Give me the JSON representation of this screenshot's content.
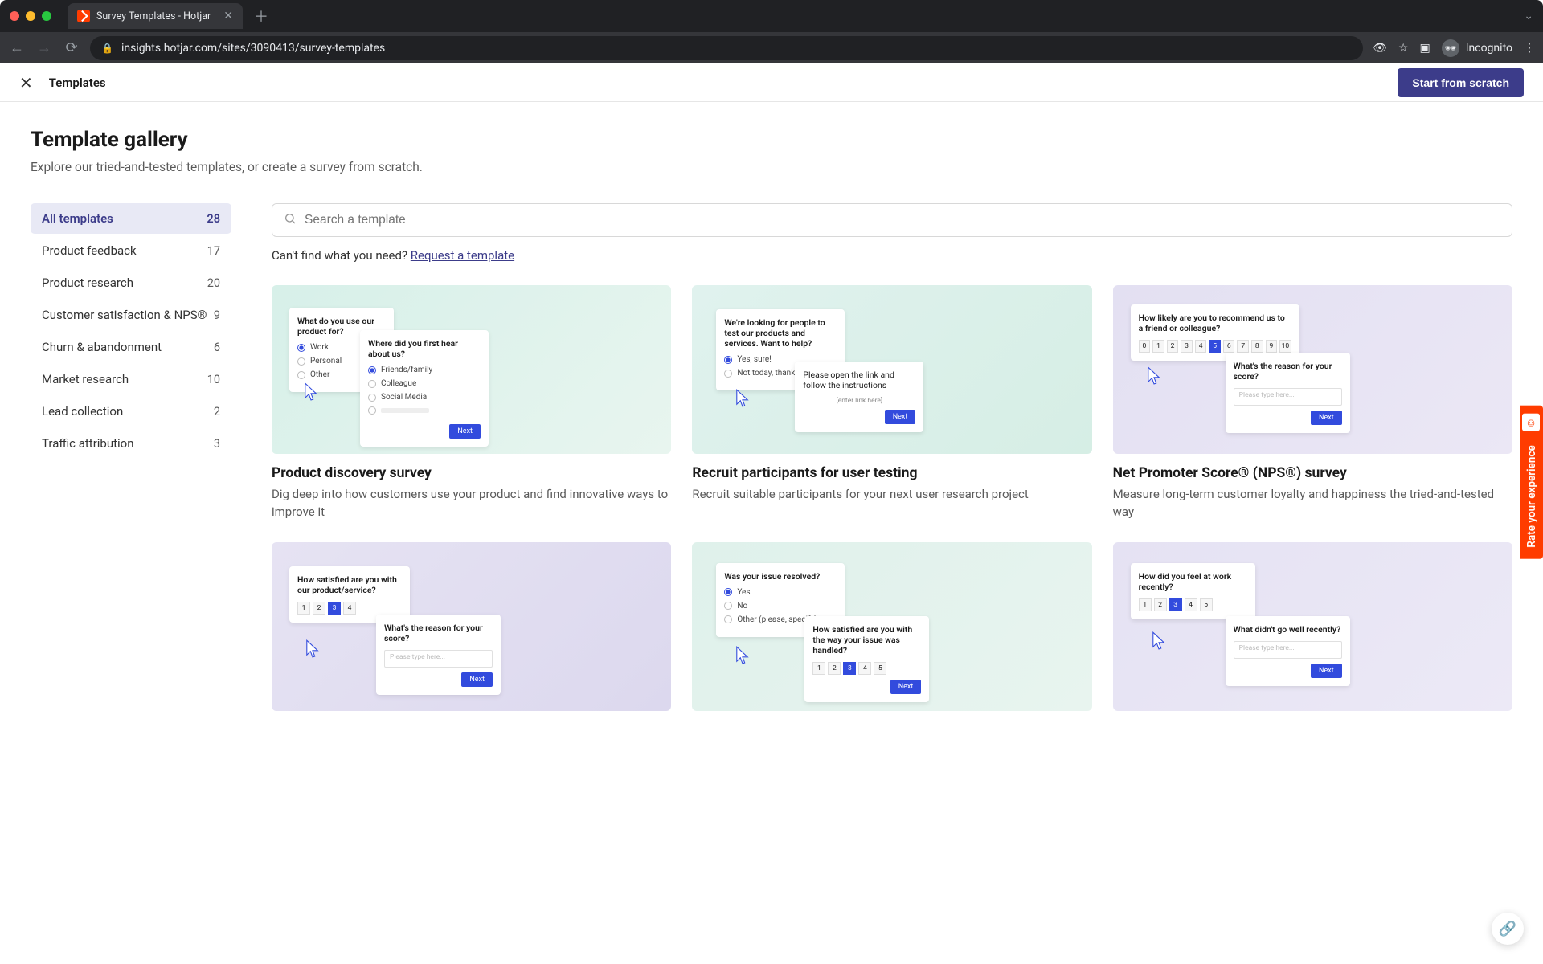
{
  "browser": {
    "tab_title": "Survey Templates - Hotjar",
    "url": "insights.hotjar.com/sites/3090413/survey-templates",
    "incognito_label": "Incognito"
  },
  "header": {
    "title": "Templates",
    "primary_button": "Start from scratch"
  },
  "page": {
    "title": "Template gallery",
    "subtitle": "Explore our tried-and-tested templates, or create a survey from scratch."
  },
  "sidebar": {
    "categories": [
      {
        "label": "All templates",
        "count": "28",
        "active": true
      },
      {
        "label": "Product feedback",
        "count": "17"
      },
      {
        "label": "Product research",
        "count": "20"
      },
      {
        "label": "Customer satisfaction & NPS®",
        "count": "9"
      },
      {
        "label": "Churn & abandonment",
        "count": "6"
      },
      {
        "label": "Market research",
        "count": "10"
      },
      {
        "label": "Lead collection",
        "count": "2"
      },
      {
        "label": "Traffic attribution",
        "count": "3"
      }
    ]
  },
  "search": {
    "placeholder": "Search a template"
  },
  "request": {
    "prefix": "Can't find what you need? ",
    "link": "Request a template"
  },
  "cards": [
    {
      "title": "Product discovery survey",
      "desc": "Dig deep into how customers use your product and find innovative ways to improve it",
      "preview": {
        "panel1_q": "What do you use our product for?",
        "panel1_opts": [
          "Work",
          "Personal",
          "Other"
        ],
        "panel1_selected": 0,
        "panel2_q": "Where did you first hear about us?",
        "panel2_opts": [
          "Friends/family",
          "Colleague",
          "Social Media"
        ],
        "panel2_selected": 0,
        "next": "Next"
      }
    },
    {
      "title": "Recruit participants for user testing",
      "desc": "Recruit suitable participants for your next user research project",
      "preview": {
        "panel1_q": "We're looking for people to test our products and services. Want to help?",
        "panel1_opts": [
          "Yes, sure!",
          "Not today, thanks"
        ],
        "panel1_selected": 0,
        "panel2_q": "Please open the link and follow the instructions",
        "panel2_placeholder": "[enter link here]",
        "next": "Next"
      }
    },
    {
      "title": "Net Promoter Score® (NPS®) survey",
      "desc": "Measure long-term customer loyalty and happiness the tried-and-tested way",
      "preview": {
        "panel1_q": "How likely are you to recommend us to a friend or colleague?",
        "scale": [
          "0",
          "1",
          "2",
          "3",
          "4",
          "5",
          "6",
          "7",
          "8",
          "9",
          "10"
        ],
        "scale_selected": 5,
        "panel2_q": "What's the reason for your score?",
        "panel2_placeholder": "Please type here...",
        "next": "Next"
      }
    },
    {
      "title": "",
      "desc": "",
      "preview": {
        "panel1_q": "How satisfied are you with our product/service?",
        "scale": [
          "1",
          "2",
          "3",
          "4"
        ],
        "scale_selected": 2,
        "panel2_q": "What's the reason for your score?",
        "panel2_placeholder": "Please type here...",
        "next": "Next"
      }
    },
    {
      "title": "",
      "desc": "",
      "preview": {
        "panel1_q": "Was your issue resolved?",
        "panel1_opts": [
          "Yes",
          "No",
          "Other (please, specify)"
        ],
        "panel1_selected": 0,
        "panel2_q": "How satisfied are you with the way your issue was handled?",
        "scale": [
          "1",
          "2",
          "3",
          "4",
          "5"
        ],
        "scale_selected": 2,
        "next": "Next"
      }
    },
    {
      "title": "",
      "desc": "",
      "preview": {
        "panel1_q": "How did you feel at work recently?",
        "scale": [
          "1",
          "2",
          "3",
          "4",
          "5"
        ],
        "scale_selected": 2,
        "panel2_q": "What didn't go well recently?",
        "panel2_placeholder": "Please type here...",
        "next": "Next"
      }
    }
  ],
  "feedback_tab": "Rate your experience"
}
